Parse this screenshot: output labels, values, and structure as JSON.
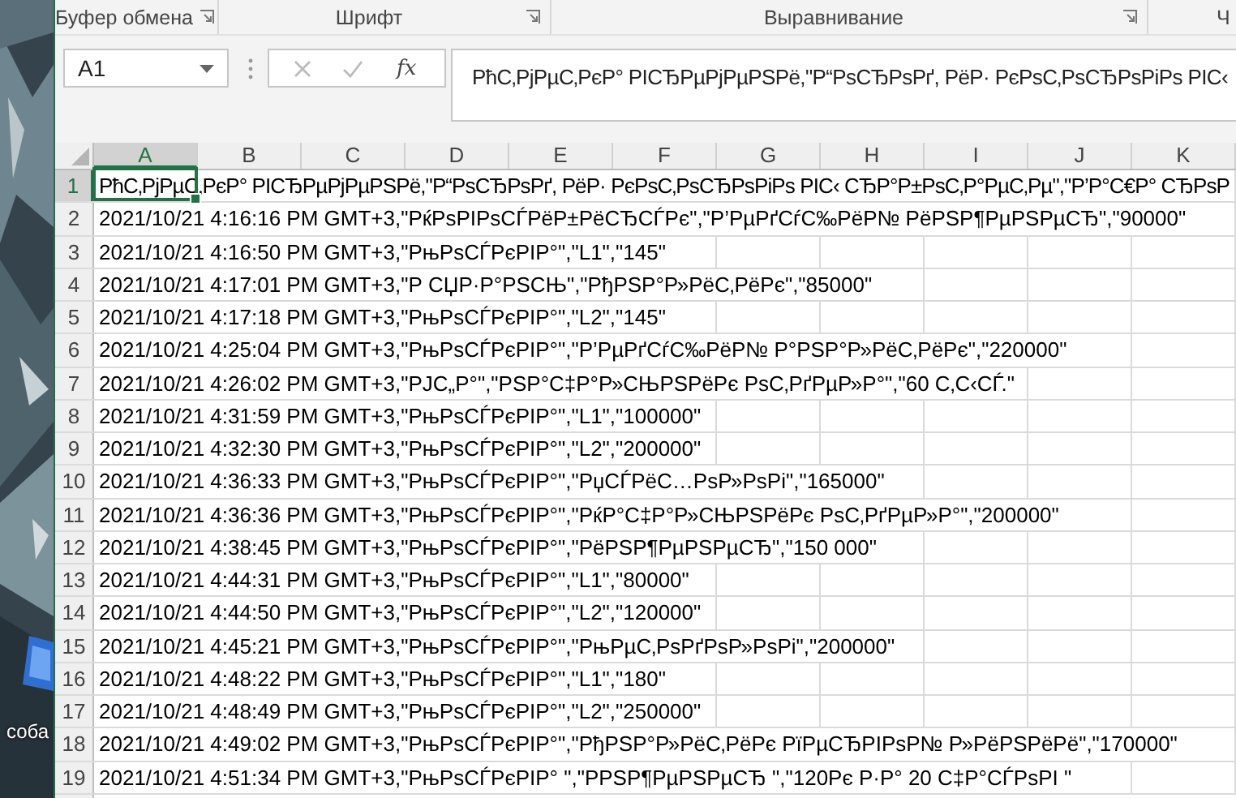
{
  "desktop": {
    "icon_label": "соба"
  },
  "ribbon_groups": [
    {
      "label": "Буфер обмена",
      "launcher": true
    },
    {
      "label": "Шрифт",
      "launcher": true
    },
    {
      "label": "Выравнивание",
      "launcher": true
    },
    {
      "label": "Ч",
      "launcher": false
    }
  ],
  "name_box": {
    "value": "A1"
  },
  "function_button": "fx",
  "formula_bar": {
    "value": "РћС‚РјРµС‚РєР° РІСЂРµРјРµРЅРё,\"Р“РѕСЂРѕРґ, РёР· РєРѕС‚РѕСЂРѕРіРѕ РІС‹"
  },
  "columns": [
    {
      "label": "A",
      "selected": true
    },
    {
      "label": "B",
      "selected": false
    },
    {
      "label": "C",
      "selected": false
    },
    {
      "label": "D",
      "selected": false
    },
    {
      "label": "E",
      "selected": false
    },
    {
      "label": "F",
      "selected": false
    },
    {
      "label": "G",
      "selected": false
    },
    {
      "label": "H",
      "selected": false
    },
    {
      "label": "I",
      "selected": false
    },
    {
      "label": "J",
      "selected": false
    },
    {
      "label": "K",
      "selected": false
    }
  ],
  "rows": [
    {
      "number": "1",
      "selected": true,
      "cell": "РћС‚РјРµС‚РєР° РІСЂРµРјРµРЅРё,\"Р“РѕСЂРѕРґ, РёР· РєРѕС‚РѕСЂРѕРіРѕ РІС‹ СЂР°Р±РѕС‚Р°РµС‚Рµ\",\"Р’Р°С€Р° СЂРѕР"
    },
    {
      "number": "2",
      "selected": false,
      "cell": "2021/10/21 4:16:16 PM GMT+3,\"РќРѕРІРѕСЃРёР±РёСЂСЃРє\",\"Р’РµРґСѓС‰РёР№ РёРЅР¶РµРЅРµСЂ\",\"90000\""
    },
    {
      "number": "3",
      "selected": false,
      "cell": "2021/10/21 4:16:50 PM GMT+3,\"РњРѕСЃРєРІР°\",\"L1\",\"145\""
    },
    {
      "number": "4",
      "selected": false,
      "cell": "2021/10/21 4:17:01 PM GMT+3,\"Р СЏР·Р°РЅСЊ\",\"РђРЅР°Р»РёС‚РёРє\",\"85000\""
    },
    {
      "number": "5",
      "selected": false,
      "cell": "2021/10/21 4:17:18 PM GMT+3,\"РњРѕСЃРєРІР°\",\"L2\",\"145\""
    },
    {
      "number": "6",
      "selected": false,
      "cell": "2021/10/21 4:25:04 PM GMT+3,\"РњРѕСЃРєРІР°\",\"Р’РµРґСѓС‰РёР№ Р°РЅР°Р»РёС‚РёРє\",\"220000\""
    },
    {
      "number": "7",
      "selected": false,
      "cell": "2021/10/21 4:26:02 PM GMT+3,\"РЈС„Р°\",\"РЅР°С‡Р°Р»СЊРЅРёРє РѕС‚РґРµР»Р°\",\"60 С‚С‹СЃ.\""
    },
    {
      "number": "8",
      "selected": false,
      "cell": "2021/10/21 4:31:59 PM GMT+3,\"РњРѕСЃРєРІР°\",\"L1\",\"100000\""
    },
    {
      "number": "9",
      "selected": false,
      "cell": "2021/10/21 4:32:30 PM GMT+3,\"РњРѕСЃРєРІР°\",\"L2\",\"200000\""
    },
    {
      "number": "10",
      "selected": false,
      "cell": "2021/10/21 4:36:33 PM GMT+3,\"РњРѕСЃРєРІР°\",\"РџСЃРёС…РѕР»РѕРі\",\"165000\""
    },
    {
      "number": "11",
      "selected": false,
      "cell": "2021/10/21 4:36:36 PM GMT+3,\"РњРѕСЃРєРІР°\",\"РќР°С‡Р°Р»СЊРЅРёРє РѕС‚РґРµР»Р°\",\"200000\""
    },
    {
      "number": "12",
      "selected": false,
      "cell": "2021/10/21 4:38:45 PM GMT+3,\"РњРѕСЃРєРІР°\",\"РёРЅР¶РµРЅРµСЂ\",\"150 000\""
    },
    {
      "number": "13",
      "selected": false,
      "cell": "2021/10/21 4:44:31 PM GMT+3,\"РњРѕСЃРєРІР°\",\"L1\",\"80000\""
    },
    {
      "number": "14",
      "selected": false,
      "cell": "2021/10/21 4:44:50 PM GMT+3,\"РњРѕСЃРєРІР°\",\"L2\",\"120000\""
    },
    {
      "number": "15",
      "selected": false,
      "cell": "2021/10/21 4:45:21 PM GMT+3,\"РњРѕСЃРєРІР°\",\"РњРµС‚РѕРґРѕР»РѕРі\",\"200000\""
    },
    {
      "number": "16",
      "selected": false,
      "cell": "2021/10/21 4:48:22 PM GMT+3,\"РњРѕСЃРєРІР°\",\"L1\",\"180\""
    },
    {
      "number": "17",
      "selected": false,
      "cell": "2021/10/21 4:48:49 PM GMT+3,\"РњРѕСЃРєРІР°\",\"L2\",\"250000\""
    },
    {
      "number": "18",
      "selected": false,
      "cell": "2021/10/21 4:49:02 PM GMT+3,\"РњРѕСЃРєРІР°\",\"РђРЅР°Р»РёС‚РёРє РїРµСЂРІРѕР№ Р»РёРЅРёРё\",\"170000\""
    },
    {
      "number": "19",
      "selected": false,
      "cell": "2021/10/21 4:51:34 PM GMT+3,\"РњРѕСЃРєРІР° \",\"РРЅР¶РµРЅРµСЂ \",\"120Рє Р·Р° 20 С‡Р°СЃРѕРІ \""
    }
  ]
}
